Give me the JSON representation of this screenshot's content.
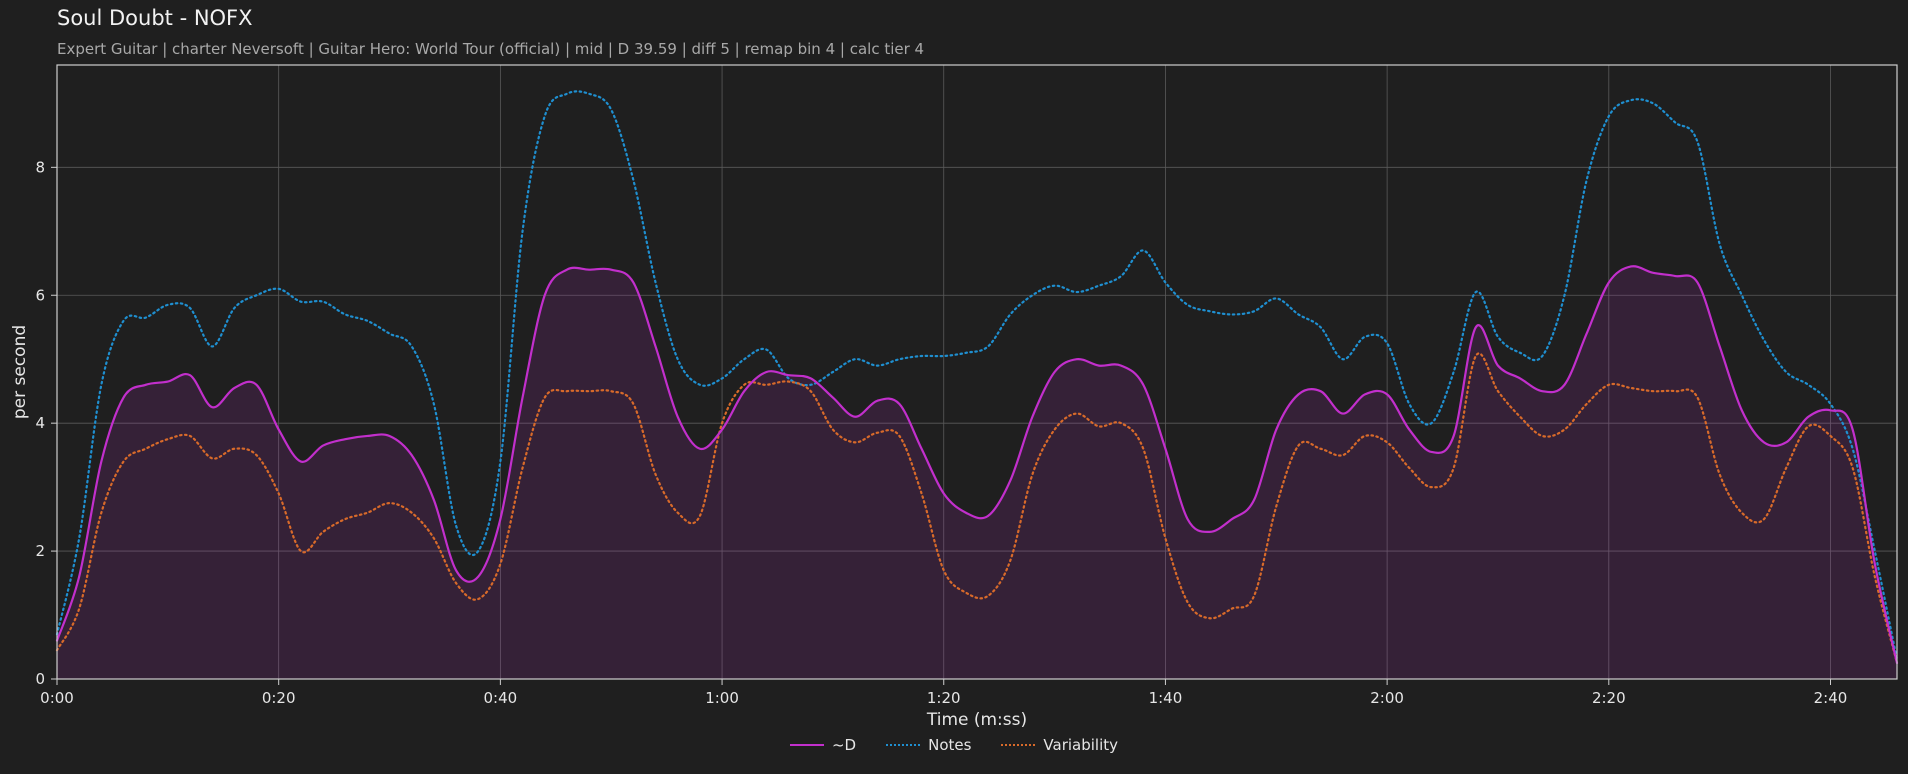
{
  "header": {
    "title": "Soul Doubt - NOFX",
    "subtitle": "Expert Guitar  |  charter Neversoft  |  Guitar Hero: World Tour (official)  |  mid  |  D 39.59  |  diff 5  |  remap bin 4  |  calc tier 4"
  },
  "chart_data": {
    "type": "line",
    "xlabel": "Time (m:ss)",
    "ylabel": "per second",
    "xlim": [
      0,
      166
    ],
    "ylim": [
      0,
      9.6
    ],
    "x_ticks": [
      {
        "value": 0,
        "label": "0:00"
      },
      {
        "value": 20,
        "label": "0:20"
      },
      {
        "value": 40,
        "label": "0:40"
      },
      {
        "value": 60,
        "label": "1:00"
      },
      {
        "value": 80,
        "label": "1:20"
      },
      {
        "value": 100,
        "label": "1:40"
      },
      {
        "value": 120,
        "label": "2:00"
      },
      {
        "value": 140,
        "label": "2:20"
      },
      {
        "value": 160,
        "label": "2:40"
      }
    ],
    "y_ticks": [
      {
        "value": 0,
        "label": "0"
      },
      {
        "value": 2,
        "label": "2"
      },
      {
        "value": 4,
        "label": "4"
      },
      {
        "value": 6,
        "label": "6"
      },
      {
        "value": 8,
        "label": "8"
      }
    ],
    "grid": true,
    "legend_position": "bottom-center",
    "x": [
      0,
      2,
      4,
      6,
      8,
      10,
      12,
      14,
      16,
      18,
      20,
      22,
      24,
      26,
      28,
      30,
      32,
      34,
      36,
      38,
      40,
      42,
      44,
      46,
      48,
      50,
      52,
      54,
      56,
      58,
      60,
      62,
      64,
      66,
      68,
      70,
      72,
      74,
      76,
      78,
      80,
      82,
      84,
      86,
      88,
      90,
      92,
      94,
      96,
      98,
      100,
      102,
      104,
      106,
      108,
      110,
      112,
      114,
      116,
      118,
      120,
      122,
      124,
      126,
      128,
      130,
      132,
      134,
      136,
      138,
      140,
      142,
      144,
      146,
      148,
      150,
      152,
      154,
      156,
      158,
      160,
      162,
      164,
      166
    ],
    "series": [
      {
        "name": "~D",
        "color": "#c22fcc",
        "style": "solid",
        "fill": true,
        "values": [
          0.6,
          1.6,
          3.4,
          4.4,
          4.6,
          4.65,
          4.75,
          4.25,
          4.55,
          4.6,
          3.9,
          3.4,
          3.65,
          3.75,
          3.8,
          3.8,
          3.5,
          2.8,
          1.7,
          1.6,
          2.5,
          4.4,
          6.0,
          6.4,
          6.4,
          6.4,
          6.2,
          5.2,
          4.1,
          3.6,
          3.9,
          4.5,
          4.8,
          4.75,
          4.7,
          4.4,
          4.1,
          4.35,
          4.3,
          3.6,
          2.9,
          2.6,
          2.55,
          3.1,
          4.1,
          4.8,
          5.0,
          4.9,
          4.9,
          4.6,
          3.6,
          2.5,
          2.3,
          2.5,
          2.8,
          3.9,
          4.45,
          4.5,
          4.15,
          4.45,
          4.45,
          3.9,
          3.55,
          3.8,
          5.5,
          4.9,
          4.7,
          4.5,
          4.6,
          5.4,
          6.2,
          6.45,
          6.35,
          6.3,
          6.2,
          5.2,
          4.2,
          3.7,
          3.7,
          4.1,
          4.2,
          3.9,
          1.8,
          0.25
        ]
      },
      {
        "name": "Notes",
        "color": "#1f8fd0",
        "style": "dotted",
        "fill": false,
        "values": [
          0.7,
          2.2,
          4.6,
          5.6,
          5.65,
          5.85,
          5.8,
          5.2,
          5.8,
          6.0,
          6.1,
          5.9,
          5.9,
          5.7,
          5.6,
          5.4,
          5.2,
          4.3,
          2.4,
          2.0,
          3.4,
          7.0,
          8.8,
          9.15,
          9.15,
          8.9,
          7.8,
          6.2,
          5.0,
          4.6,
          4.7,
          5.0,
          5.15,
          4.7,
          4.6,
          4.8,
          5.0,
          4.9,
          5.0,
          5.05,
          5.05,
          5.1,
          5.2,
          5.7,
          6.0,
          6.15,
          6.05,
          6.15,
          6.3,
          6.7,
          6.2,
          5.85,
          5.75,
          5.7,
          5.75,
          5.95,
          5.7,
          5.5,
          5.0,
          5.35,
          5.25,
          4.3,
          4.0,
          4.8,
          6.05,
          5.35,
          5.1,
          5.05,
          6.0,
          7.8,
          8.8,
          9.05,
          9.0,
          8.7,
          8.4,
          6.8,
          6.0,
          5.3,
          4.8,
          4.6,
          4.3,
          3.6,
          2.0,
          0.3
        ]
      },
      {
        "name": "Variability",
        "color": "#d86a2a",
        "style": "dotted",
        "fill": false,
        "values": [
          0.45,
          1.1,
          2.6,
          3.4,
          3.6,
          3.75,
          3.8,
          3.45,
          3.6,
          3.5,
          2.9,
          2.0,
          2.3,
          2.5,
          2.6,
          2.75,
          2.6,
          2.2,
          1.5,
          1.25,
          1.8,
          3.3,
          4.4,
          4.5,
          4.5,
          4.5,
          4.3,
          3.2,
          2.6,
          2.55,
          4.0,
          4.6,
          4.6,
          4.65,
          4.5,
          3.9,
          3.7,
          3.85,
          3.8,
          2.9,
          1.7,
          1.35,
          1.3,
          1.85,
          3.2,
          3.9,
          4.15,
          3.95,
          4.0,
          3.6,
          2.2,
          1.2,
          0.95,
          1.1,
          1.3,
          2.7,
          3.65,
          3.6,
          3.5,
          3.8,
          3.7,
          3.3,
          3.0,
          3.3,
          5.05,
          4.5,
          4.1,
          3.8,
          3.9,
          4.3,
          4.6,
          4.55,
          4.5,
          4.5,
          4.4,
          3.2,
          2.6,
          2.5,
          3.3,
          3.95,
          3.8,
          3.3,
          1.6,
          0.25
        ]
      }
    ]
  }
}
